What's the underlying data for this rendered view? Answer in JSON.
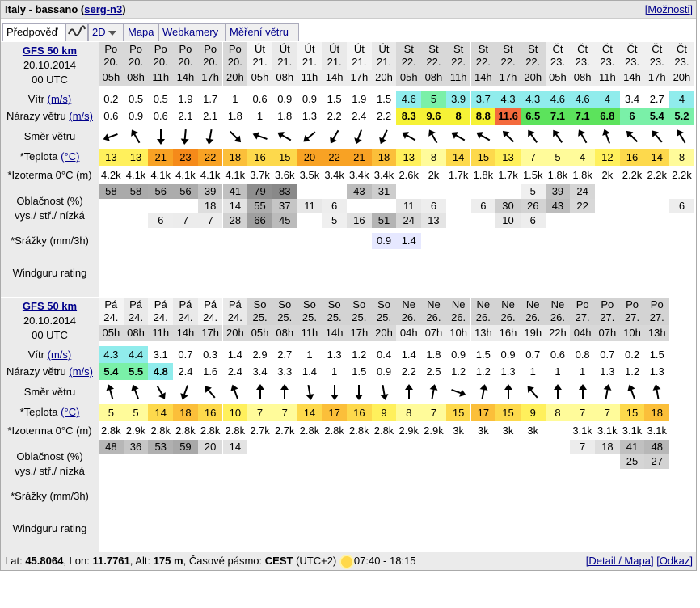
{
  "header": {
    "title": "Italy - bassano",
    "user": "serg-n3",
    "options_link": "[Možnosti]"
  },
  "tabs": {
    "forecast": "Předpověď",
    "mode": "2D",
    "map": "Mapa",
    "webcams": "Webkamery",
    "wind_measure": "Měření větru"
  },
  "labels": {
    "wind": "Vítr",
    "wind_unit": "(m/s)",
    "gusts": "Nárazy větru",
    "gusts_unit": "(m/s)",
    "direction": "Směr větru",
    "temp": "*Teplota",
    "temp_unit": "(°C)",
    "isotherm": "*Izoterma 0°C (m)",
    "cloud1": "Oblačnost (%)",
    "cloud2": "vys./ stř./ nízká",
    "precip": "*Srážky (mm/3h)",
    "rating": "Windguru rating"
  },
  "blocks": [
    {
      "model": "GFS 50 km",
      "init_date": "20.10.2014",
      "init_time": "00 UTC",
      "days": [
        "Po",
        "Po",
        "Po",
        "Po",
        "Po",
        "Po",
        "Út",
        "Út",
        "Út",
        "Út",
        "Út",
        "Út",
        "St",
        "St",
        "St",
        "St",
        "St",
        "St",
        "Čt",
        "Čt",
        "Čt",
        "Čt",
        "Čt",
        "Čt"
      ],
      "dates": [
        "20.",
        "20.",
        "20.",
        "20.",
        "20.",
        "20.",
        "21.",
        "21.",
        "21.",
        "21.",
        "21.",
        "21.",
        "22.",
        "22.",
        "22.",
        "22.",
        "22.",
        "22.",
        "23.",
        "23.",
        "23.",
        "23.",
        "23.",
        "23."
      ],
      "hours": [
        "05h",
        "08h",
        "11h",
        "14h",
        "17h",
        "20h",
        "05h",
        "08h",
        "11h",
        "14h",
        "17h",
        "20h",
        "05h",
        "08h",
        "11h",
        "14h",
        "17h",
        "20h",
        "05h",
        "08h",
        "11h",
        "14h",
        "17h",
        "20h"
      ],
      "wind": [
        "0.2",
        "0.5",
        "0.5",
        "1.9",
        "1.7",
        "1",
        "0.6",
        "0.9",
        "0.9",
        "1.5",
        "1.9",
        "1.5",
        "4.6",
        "5",
        "3.9",
        "3.7",
        "4.3",
        "4.3",
        "4.6",
        "4.6",
        "4",
        "3.4",
        "2.7",
        "4"
      ],
      "gusts": [
        "0.6",
        "0.9",
        "0.6",
        "2.1",
        "2.1",
        "1.8",
        "1",
        "1.8",
        "1.3",
        "2.2",
        "2.4",
        "2.2",
        "8.3",
        "9.6",
        "8",
        "8.8",
        "11.6",
        "6.5",
        "7.1",
        "7.1",
        "6.8",
        "6",
        "5.4",
        "5.2"
      ],
      "dir_deg": [
        250,
        330,
        180,
        185,
        190,
        135,
        290,
        300,
        230,
        210,
        200,
        205,
        300,
        330,
        300,
        300,
        315,
        325,
        325,
        330,
        340,
        315,
        320,
        330
      ],
      "temp": [
        "13",
        "13",
        "21",
        "23",
        "22",
        "18",
        "16",
        "15",
        "20",
        "22",
        "21",
        "18",
        "13",
        "8",
        "14",
        "15",
        "13",
        "7",
        "5",
        "4",
        "12",
        "16",
        "14",
        "8"
      ],
      "isotherm": [
        "4.2k",
        "4.1k",
        "4.1k",
        "4.1k",
        "4.1k",
        "4.1k",
        "3.7k",
        "3.6k",
        "3.5k",
        "3.4k",
        "3.4k",
        "3.4k",
        "2.6k",
        "2k",
        "1.7k",
        "1.8k",
        "1.7k",
        "1.5k",
        "1.8k",
        "1.8k",
        "2k",
        "2.2k",
        "2.2k",
        "2.2k"
      ],
      "cloud_high": [
        "58",
        "58",
        "56",
        "56",
        "39",
        "41",
        "79",
        "83",
        "",
        "",
        "43",
        "31",
        "",
        "",
        "",
        "",
        "",
        "5",
        "39",
        "24",
        "",
        "",
        "",
        ""
      ],
      "cloud_mid": [
        "",
        "",
        "",
        "",
        "18",
        "14",
        "55",
        "37",
        "11",
        "6",
        "",
        "",
        "11",
        "6",
        "",
        "6",
        "30",
        "26",
        "43",
        "22",
        "",
        "",
        "",
        "6"
      ],
      "cloud_low": [
        "",
        "",
        "6",
        "7",
        "7",
        "28",
        "66",
        "45",
        "",
        "5",
        "16",
        "51",
        "24",
        "13",
        "",
        "",
        "10",
        "6",
        "",
        "",
        "",
        "",
        "",
        ""
      ],
      "precip": [
        "",
        "",
        "",
        "",
        "",
        "",
        "",
        "",
        "",
        "",
        "",
        "0.9",
        "1.4",
        "",
        "",
        "",
        "",
        "",
        "",
        "",
        "",
        "",
        "",
        ""
      ]
    },
    {
      "model": "GFS 50 km",
      "init_date": "20.10.2014",
      "init_time": "00 UTC",
      "days": [
        "Pá",
        "Pá",
        "Pá",
        "Pá",
        "Pá",
        "Pá",
        "So",
        "So",
        "So",
        "So",
        "So",
        "So",
        "Ne",
        "Ne",
        "Ne",
        "Ne",
        "Ne",
        "Ne",
        "Ne",
        "Po",
        "Po",
        "Po",
        "Po"
      ],
      "dates": [
        "24.",
        "24.",
        "24.",
        "24.",
        "24.",
        "24.",
        "25.",
        "25.",
        "25.",
        "25.",
        "25.",
        "25.",
        "26.",
        "26.",
        "26.",
        "26.",
        "26.",
        "26.",
        "26.",
        "27.",
        "27.",
        "27.",
        "27."
      ],
      "hours": [
        "05h",
        "08h",
        "11h",
        "14h",
        "17h",
        "20h",
        "05h",
        "08h",
        "11h",
        "14h",
        "17h",
        "20h",
        "04h",
        "07h",
        "10h",
        "13h",
        "16h",
        "19h",
        "22h",
        "04h",
        "07h",
        "10h",
        "13h"
      ],
      "wind": [
        "4.3",
        "4.4",
        "3.1",
        "0.7",
        "0.3",
        "1.4",
        "2.9",
        "2.7",
        "1",
        "1.3",
        "1.2",
        "0.4",
        "1.4",
        "1.8",
        "0.9",
        "1.5",
        "0.9",
        "0.7",
        "0.6",
        "0.8",
        "0.7",
        "0.2",
        "1.5"
      ],
      "gusts": [
        "5.4",
        "5.5",
        "4.8",
        "2.4",
        "1.6",
        "2.4",
        "3.4",
        "3.3",
        "1.4",
        "1",
        "1.5",
        "0.9",
        "2.2",
        "2.5",
        "1.2",
        "1.2",
        "1.3",
        "1",
        "1",
        "1",
        "1.3",
        "1.2",
        "1.3"
      ],
      "dir_deg": [
        345,
        340,
        150,
        200,
        320,
        340,
        0,
        0,
        170,
        180,
        180,
        170,
        0,
        10,
        110,
        10,
        0,
        320,
        0,
        0,
        10,
        340,
        350
      ],
      "temp": [
        "5",
        "5",
        "14",
        "18",
        "16",
        "10",
        "7",
        "7",
        "14",
        "17",
        "16",
        "9",
        "8",
        "7",
        "15",
        "17",
        "15",
        "9",
        "8",
        "7",
        "7",
        "15",
        "18"
      ],
      "isotherm": [
        "2.8k",
        "2.9k",
        "2.8k",
        "2.8k",
        "2.8k",
        "2.8k",
        "2.7k",
        "2.7k",
        "2.8k",
        "2.8k",
        "2.8k",
        "2.8k",
        "2.9k",
        "2.9k",
        "3k",
        "3k",
        "3k",
        "3k",
        "",
        "3.1k",
        "3.1k",
        "3.1k",
        "3.1k"
      ],
      "cloud_high": [
        "48",
        "36",
        "53",
        "59",
        "20",
        "14",
        "",
        "",
        "",
        "",
        "",
        "",
        "",
        "",
        "",
        "",
        "",
        "",
        "",
        "7",
        "18",
        "41",
        "48"
      ],
      "cloud_mid": [
        "",
        "",
        "",
        "",
        "",
        "",
        "",
        "",
        "",
        "",
        "",
        "",
        "",
        "",
        "",
        "",
        "",
        "",
        "",
        "",
        "",
        "25",
        "27"
      ],
      "cloud_low": [
        "",
        "",
        "",
        "",
        "",
        "",
        "",
        "",
        "",
        "",
        "",
        "",
        "",
        "",
        "",
        "",
        "",
        "",
        "",
        "",
        "",
        "",
        ""
      ],
      "precip": [
        "",
        "",
        "",
        "",
        "",
        "",
        "",
        "",
        "",
        "",
        "",
        "",
        "",
        "",
        "",
        "",
        "",
        "",
        "",
        "",
        "",
        "",
        ""
      ]
    }
  ],
  "footer": {
    "lat_label": "Lat:",
    "lat": "45.8064",
    "lon_label": "Lon:",
    "lon": "11.7761",
    "alt_label": "Alt:",
    "alt": "175 m",
    "tz_label": "Časové pásmo:",
    "tz": "CEST",
    "tz_offset": "(UTC+2)",
    "sun": "07:40 - 18:15",
    "detail_link": "[Detail / Mapa]",
    "link_link": "[Odkaz]"
  }
}
